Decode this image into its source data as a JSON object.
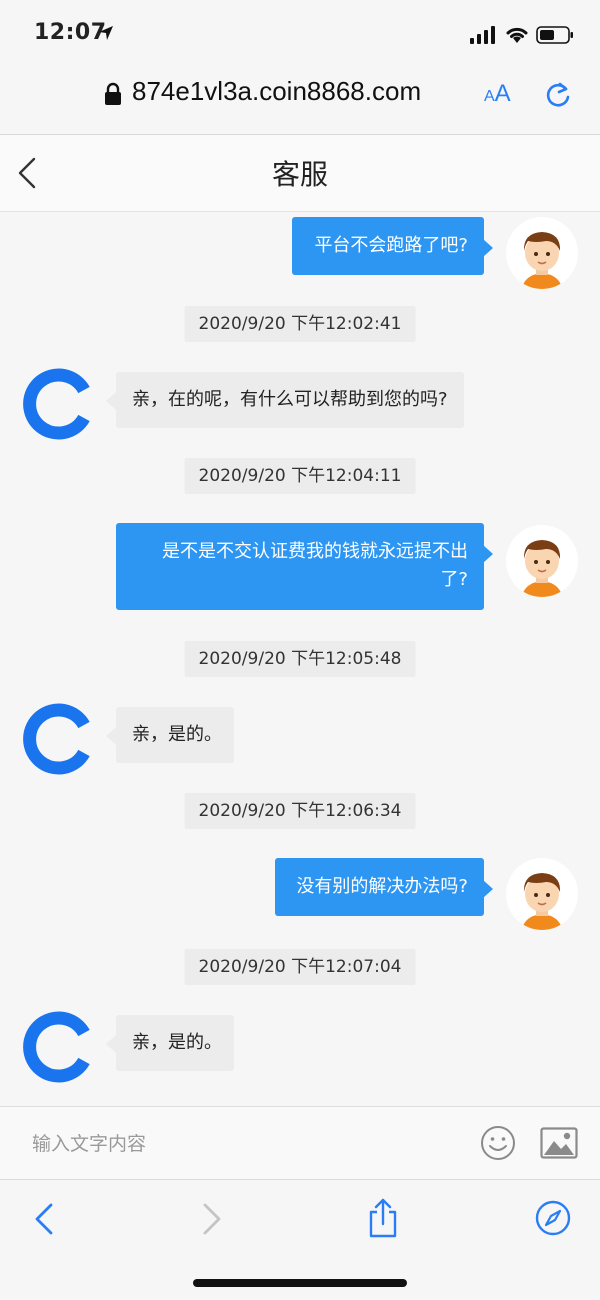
{
  "status_bar": {
    "time": "12:07"
  },
  "browser": {
    "url": "874e1vl3a.coin8868.com",
    "text_size_small": "A",
    "text_size_large": "A"
  },
  "chat": {
    "title": "客服",
    "messages": [
      {
        "type": "user",
        "text": "平台不会跑路了吧?"
      },
      {
        "type": "timestamp",
        "text": "2020/9/20 下午12:02:41"
      },
      {
        "type": "agent",
        "text": "亲，在的呢，有什么可以帮助到您的吗?"
      },
      {
        "type": "timestamp",
        "text": "2020/9/20 下午12:04:11"
      },
      {
        "type": "user",
        "text_line1": "是不是不交认证费我的钱就永远提不出",
        "text_line2": "了?"
      },
      {
        "type": "timestamp",
        "text": "2020/9/20 下午12:05:48"
      },
      {
        "type": "agent",
        "text": "亲，是的。"
      },
      {
        "type": "timestamp",
        "text": "2020/9/20 下午12:06:34"
      },
      {
        "type": "user",
        "text": "没有别的解决办法吗?"
      },
      {
        "type": "timestamp",
        "text": "2020/9/20 下午12:07:04"
      },
      {
        "type": "agent",
        "text": "亲，是的。"
      }
    ]
  },
  "input": {
    "placeholder": "输入文字内容"
  },
  "colors": {
    "accent": "#2a7df5",
    "user_bubble": "#2d96f3",
    "agent_bubble": "#ececec"
  }
}
